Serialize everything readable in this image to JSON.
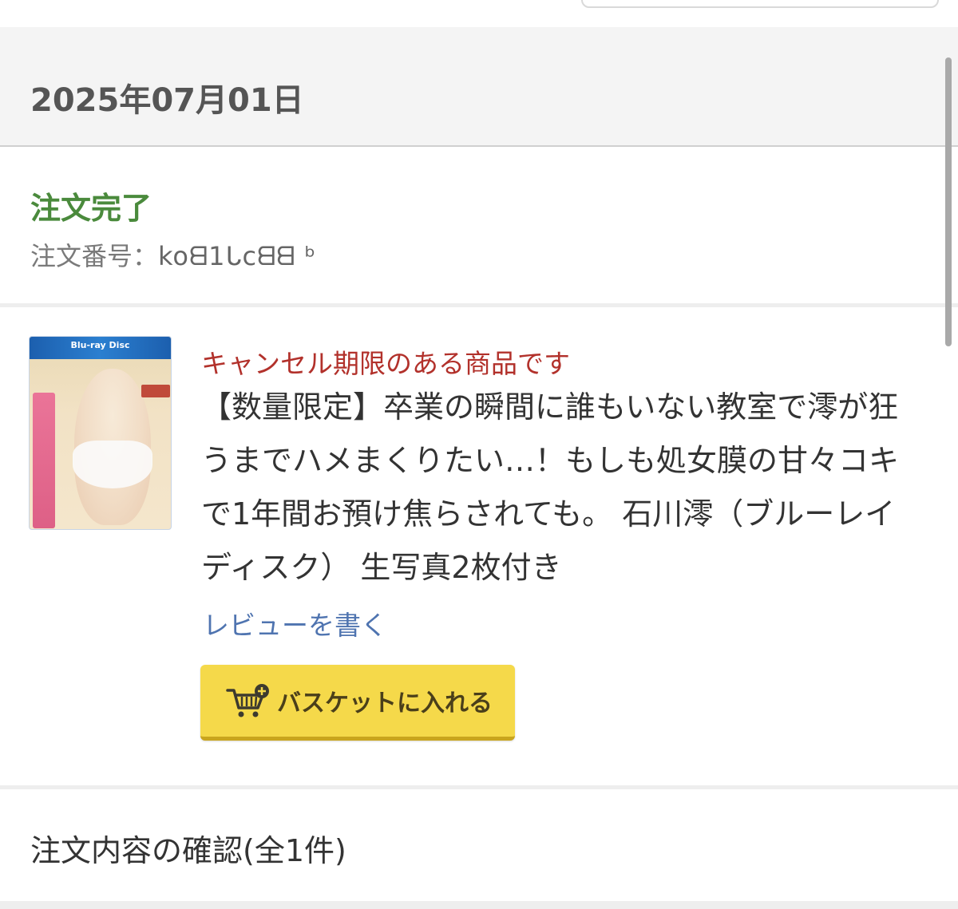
{
  "order_group": {
    "date": "2025年07月01日",
    "status": "注文完了",
    "order_number_label": "注文番号：",
    "order_number_value": "koᗺ1ᒐcᗺᗺ  ᵇ"
  },
  "item": {
    "cancel_note": "キャンセル期限のある商品です",
    "title": "【数量限定】卒業の瞬間に誰もいない教室で澪が狂うまでハメまくりたい…！もしも処女膜の甘々コキで1年間お預け焦らされても。 石川澪（ブルーレイディスク） 生写真2枚付き",
    "thumb_band_label": "Blu-ray Disc",
    "review_link": "レビューを書く",
    "basket_button_label": "バスケットに入れる",
    "basket_icon": "cart-plus-icon"
  },
  "confirm": {
    "label": "注文内容の確認(全1件)"
  },
  "colors": {
    "status_green": "#4a8a3c",
    "cancel_red": "#b2312b",
    "link_blue": "#4f74b0",
    "button_yellow": "#f5d94a"
  }
}
